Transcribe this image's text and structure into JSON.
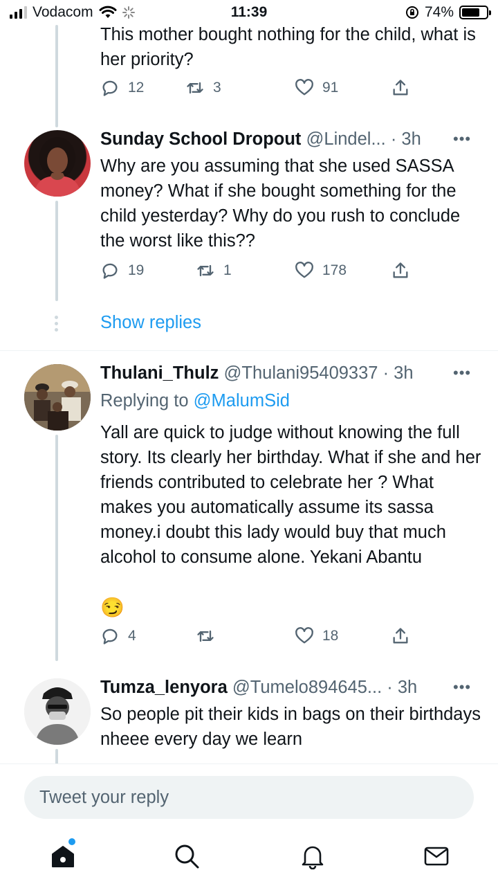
{
  "status_bar": {
    "carrier": "Vodacom",
    "time": "11:39",
    "battery_percent": "74%",
    "battery_level": 0.74
  },
  "tweets": [
    {
      "text": "This mother bought nothing for the child, what is her priority?",
      "replies": "12",
      "retweets": "3",
      "likes": "91"
    },
    {
      "name": "Sunday School Dropout",
      "handle": "@Lindel...",
      "time": "· 3h",
      "text": "Why are you assuming that she used SASSA money? What if she bought something for the child yesterday? Why do you rush to conclude the worst like this??",
      "replies": "19",
      "retweets": "1",
      "likes": "178"
    },
    {
      "name": "Thulani_Thulz",
      "handle": "@Thulani95409337",
      "time": "· 3h",
      "replying_label": "Replying to",
      "replying_to": "@MalumSid",
      "text": "Yall are quick to judge without knowing the full story. Its  clearly her birthday. What if she and her friends contributed to celebrate her ?  What makes you automatically assume its sassa money.i doubt this lady would buy that much alcohol to consume alone. Yekani Abantu",
      "emoji": "😏",
      "replies": "4",
      "retweets": "",
      "likes": "18"
    },
    {
      "name": "Tumza_lenyora",
      "handle": "@Tumelo894645...",
      "time": "· 3h",
      "text": "So people pit their kids in bags on their birthdays nheee every day we learn"
    }
  ],
  "show_replies": "Show replies",
  "more_glyph": "•••",
  "reply_placeholder": "Tweet your reply",
  "colors": {
    "accent": "#1d9bf0",
    "secondary_text": "#536471",
    "thread_line": "#cfd9de"
  }
}
